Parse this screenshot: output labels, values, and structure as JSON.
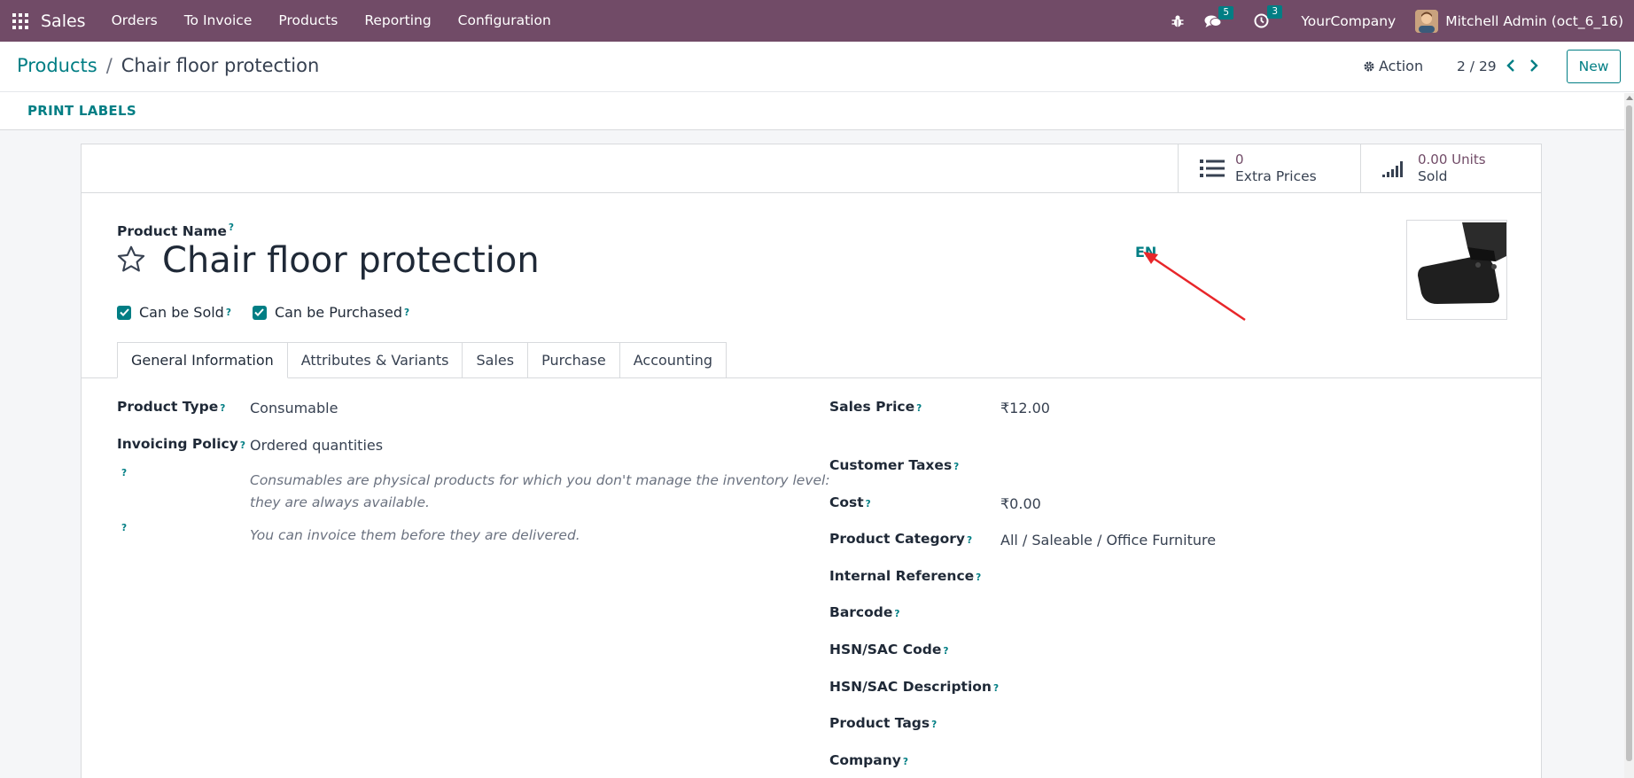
{
  "topnav": {
    "brand": "Sales",
    "menu": [
      "Orders",
      "To Invoice",
      "Products",
      "Reporting",
      "Configuration"
    ],
    "chat_count": "5",
    "activity_count": "3",
    "company": "YourCompany",
    "user": "Mitchell Admin (oct_6_16)"
  },
  "control_panel": {
    "breadcrumb_parent": "Products",
    "breadcrumb_sep": "/",
    "breadcrumb_current": "Chair floor protection",
    "action_label": "Action",
    "pager": "2 / 29",
    "new_label": "New"
  },
  "statusbar": {
    "print_labels": "PRINT LABELS"
  },
  "smart_buttons": [
    {
      "value": "0",
      "label": "Extra Prices",
      "icon": "list-icon"
    },
    {
      "value": "0.00 Units",
      "label": "Sold",
      "icon": "signal-bars-icon"
    }
  ],
  "product": {
    "name_label": "Product Name",
    "name": "Chair floor protection",
    "lang": "EN",
    "can_be_sold_label": "Can be Sold",
    "can_be_sold": true,
    "can_be_purchased_label": "Can be Purchased",
    "can_be_purchased": true
  },
  "tabs": [
    "General Information",
    "Attributes & Variants",
    "Sales",
    "Purchase",
    "Accounting"
  ],
  "active_tab": "General Information",
  "general": {
    "product_type_label": "Product Type",
    "product_type": "Consumable",
    "invoicing_policy_label": "Invoicing Policy",
    "invoicing_policy": "Ordered quantities",
    "note_consumable_1": "Consumables are physical products for which you don't manage the inventory level:",
    "note_consumable_2": "they are always available.",
    "note_invoice": "You can invoice them before they are delivered.",
    "sales_price_label": "Sales Price",
    "sales_price": "₹12.00",
    "customer_taxes_label": "Customer Taxes",
    "cost_label": "Cost",
    "cost": "₹0.00",
    "product_category_label": "Product Category",
    "product_category": "All / Saleable / Office Furniture",
    "internal_reference_label": "Internal Reference",
    "barcode_label": "Barcode",
    "hsn_code_label": "HSN/SAC Code",
    "hsn_desc_label": "HSN/SAC Description",
    "product_tags_label": "Product Tags",
    "company_label": "Company"
  },
  "help_marker": "?",
  "colors": {
    "brand": "#714B67",
    "accent": "#017e84",
    "annotation_arrow": "#e8262a"
  }
}
